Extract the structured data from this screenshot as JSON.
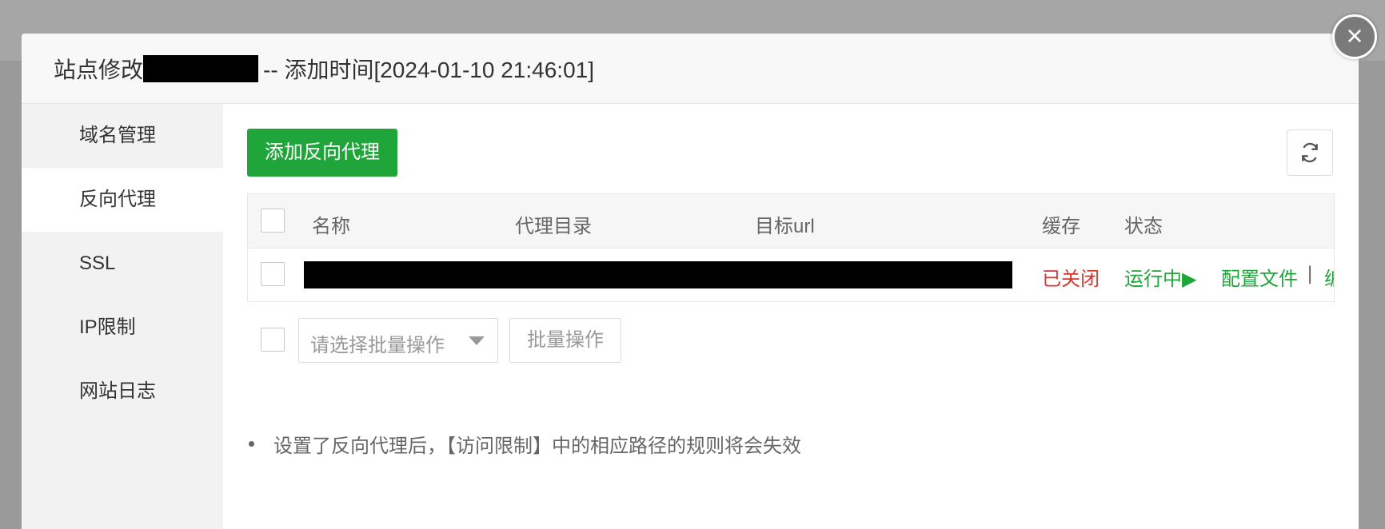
{
  "header": {
    "title_prefix": "站点修改",
    "title_suffix": "-- 添加时间[2024-01-10 21:46:01]",
    "close_icon": "close-icon"
  },
  "sidebar": {
    "items": [
      {
        "label": "域名管理",
        "active": false
      },
      {
        "label": "反向代理",
        "active": true
      },
      {
        "label": "SSL",
        "active": false
      },
      {
        "label": "IP限制",
        "active": false
      },
      {
        "label": "网站日志",
        "active": false
      }
    ]
  },
  "toolbar": {
    "add_label": "添加反向代理",
    "refresh_icon": "refresh-icon",
    "accent_color": "#20a53a"
  },
  "table": {
    "headers": {
      "name": "名称",
      "proxy_dir": "代理目录",
      "target_url": "目标url",
      "cache": "缓存",
      "status": "状态"
    },
    "rows": [
      {
        "cache": "已关闭",
        "status": "运行中▶",
        "action_config": "配置文件",
        "separator": "|",
        "action_edit_partial": "编"
      }
    ]
  },
  "batch": {
    "select_placeholder": "请选择批量操作",
    "button_label": "批量操作"
  },
  "notice": {
    "text": "设置了反向代理后，【访问限制】中的相应路径的规则将会失效"
  },
  "colors": {
    "closed": "#d9362b",
    "running": "#20a53a"
  }
}
